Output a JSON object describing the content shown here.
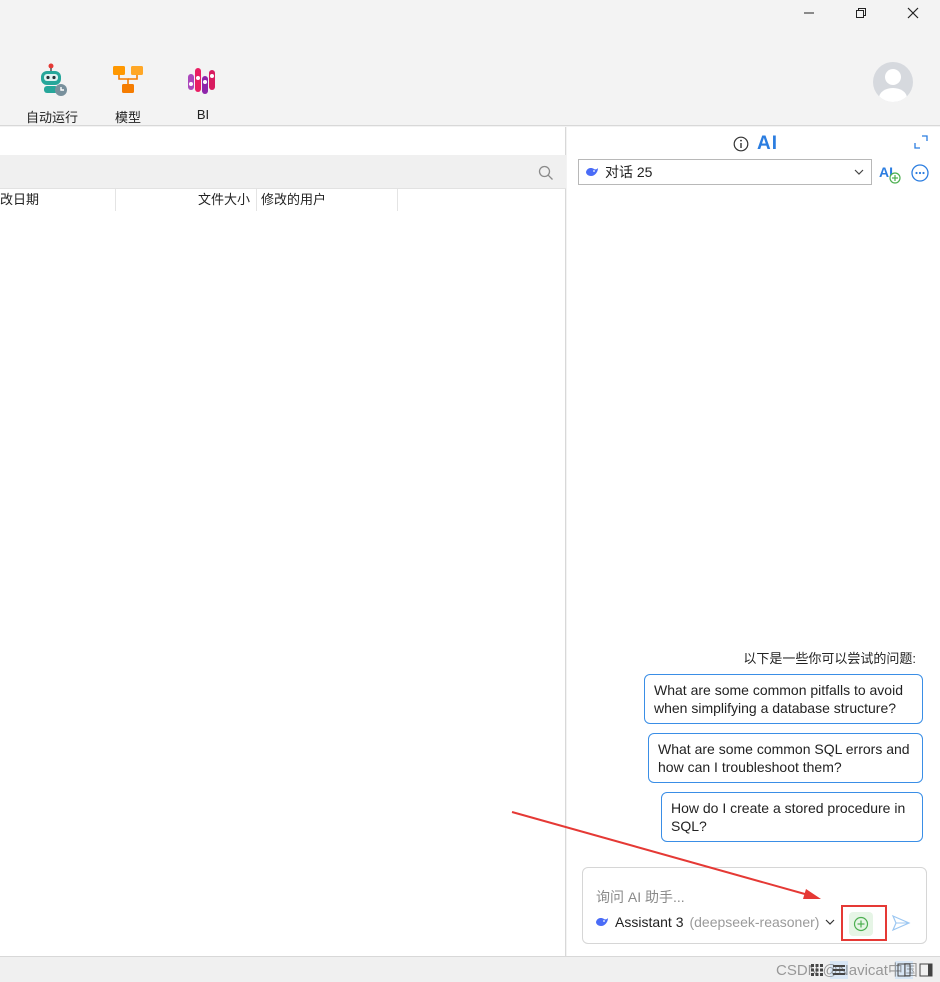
{
  "toolbar": {
    "items": [
      {
        "label": "自动运行",
        "icon": "robot-icon"
      },
      {
        "label": "模型",
        "icon": "model-icon"
      },
      {
        "label": "BI",
        "icon": "bi-icon"
      }
    ]
  },
  "file_list": {
    "columns": [
      "改日期",
      "文件大小",
      "修改的用户"
    ]
  },
  "ai_panel": {
    "header": "AI",
    "conversation": "对话 25",
    "suggestions_title": "以下是一些你可以尝试的问题:",
    "suggestions": [
      "What are some common pitfalls to avoid when simplifying a database structure?",
      "What are some common SQL errors and how can I troubleshoot them?",
      "How do I create a stored procedure in SQL?"
    ],
    "input_placeholder": "询问 AI 助手...",
    "assistant_name": "Assistant 3",
    "assistant_model": "(deepseek-reasoner)"
  },
  "watermark": "CSDN @Navicat中国",
  "colors": {
    "accent": "#2b7de0",
    "suggestion_border": "#3a8ee6",
    "highlight": "#e53935",
    "add_green": "#4caf50"
  }
}
